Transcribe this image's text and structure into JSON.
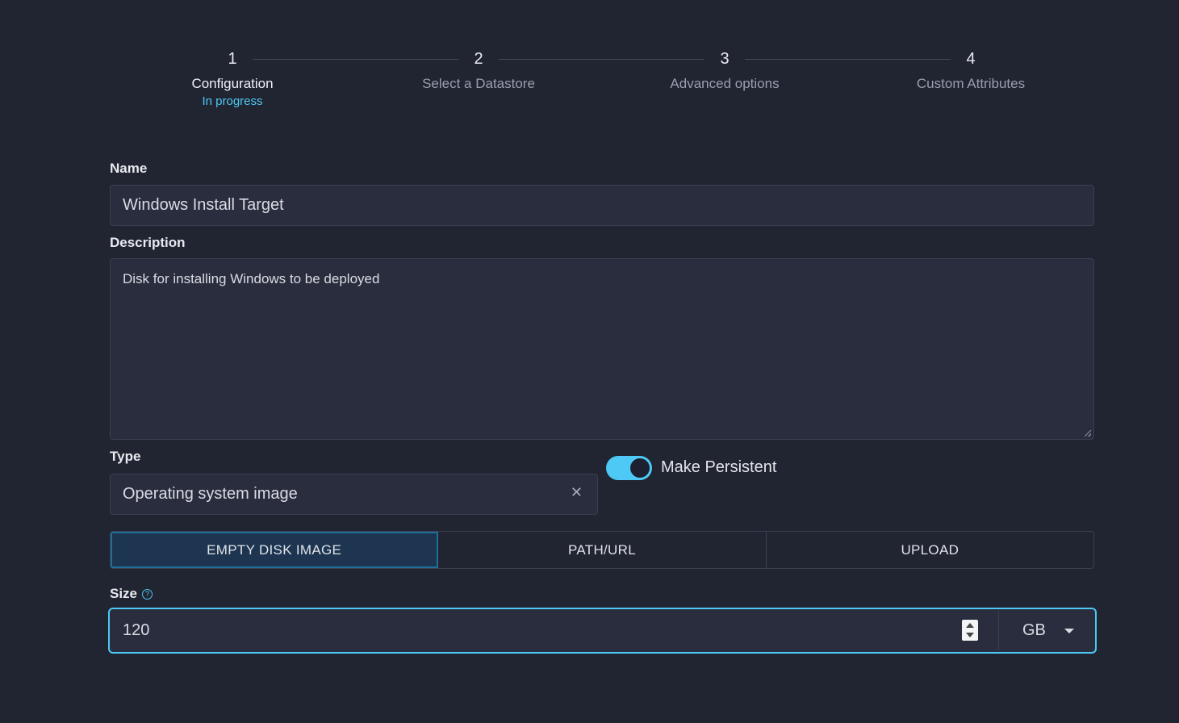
{
  "stepper": {
    "steps": [
      {
        "number": "1",
        "title": "Configuration",
        "status": "In progress"
      },
      {
        "number": "2",
        "title": "Select a Datastore"
      },
      {
        "number": "3",
        "title": "Advanced options"
      },
      {
        "number": "4",
        "title": "Custom Attributes"
      }
    ]
  },
  "form": {
    "name_label": "Name",
    "name_value": "Windows Install Target",
    "description_label": "Description",
    "description_value": "Disk for installing Windows to be deployed",
    "type_label": "Type",
    "type_value": "Operating system image",
    "persistent_label": "Make Persistent",
    "persistent_on": true,
    "source_options": [
      "EMPTY DISK IMAGE",
      "PATH/URL",
      "UPLOAD"
    ],
    "source_selected": "EMPTY DISK IMAGE",
    "size_label": "Size",
    "size_value": "120",
    "size_unit": "GB"
  },
  "colors": {
    "background": "#212431",
    "accent": "#4ec8f4",
    "field_bg": "#2a2d3d"
  },
  "icons": [
    "clear-icon",
    "help-icon",
    "spinner-icon",
    "chevron-down-icon"
  ]
}
